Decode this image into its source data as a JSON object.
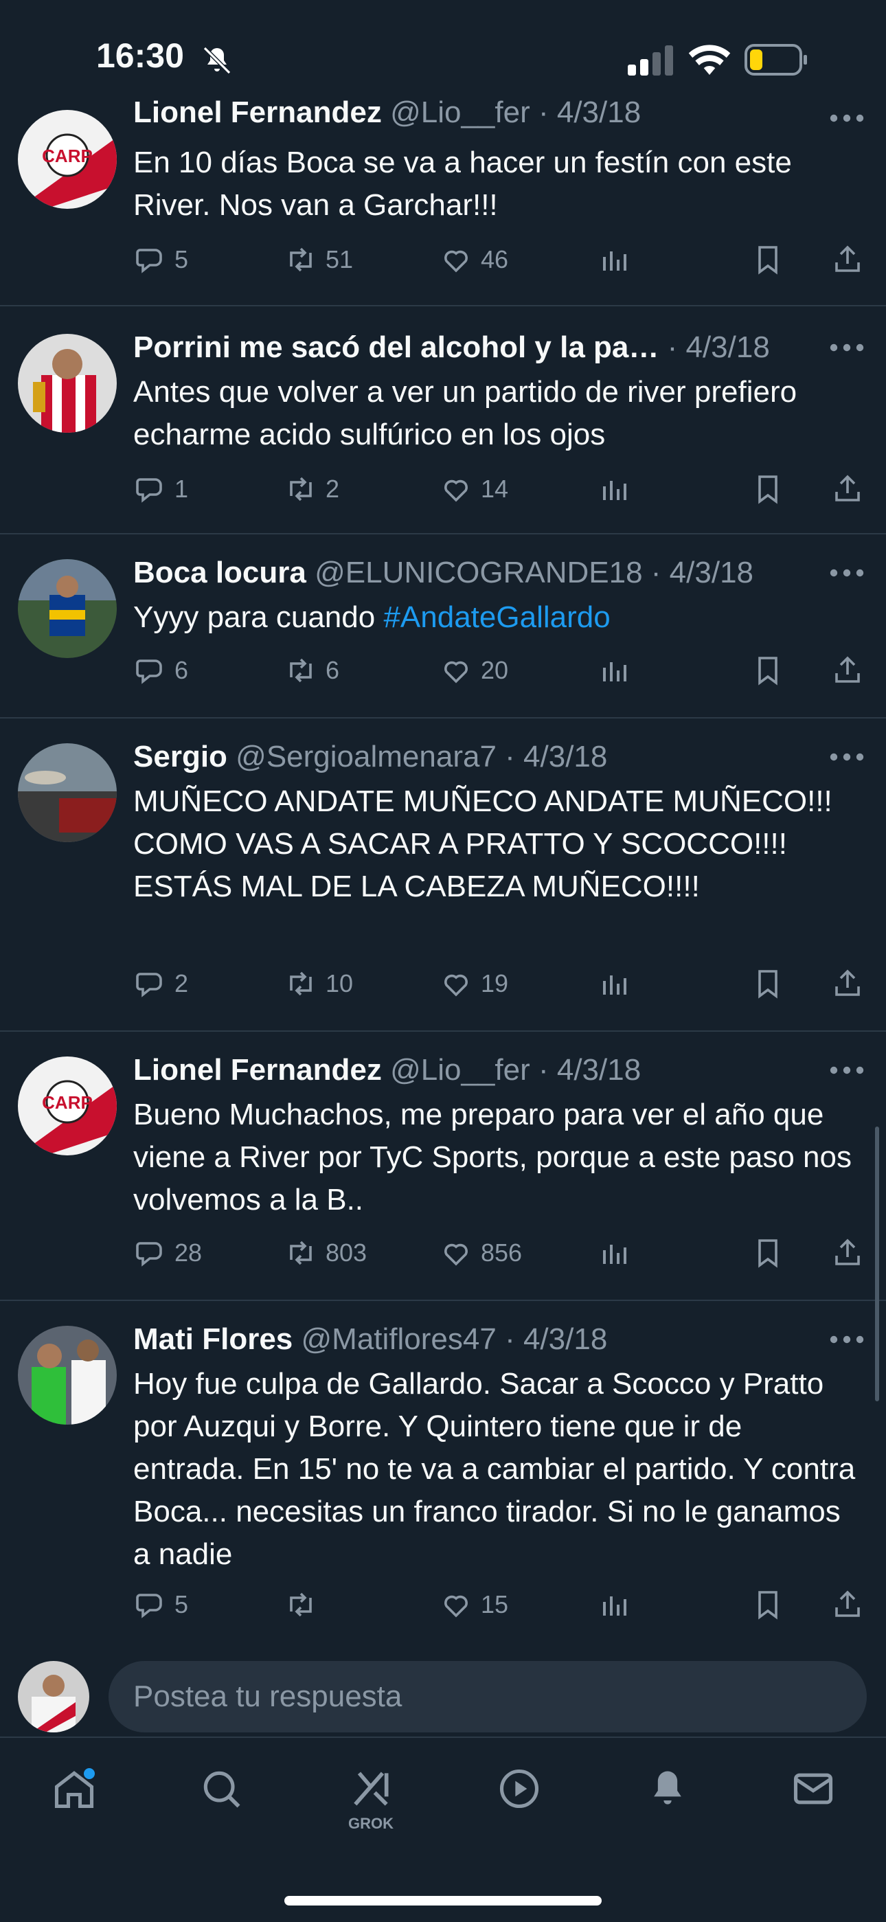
{
  "status_bar": {
    "time": "16:30"
  },
  "tweets": [
    {
      "name": "Lionel Fernandez",
      "handle": "@Lio__fer",
      "sep": " · ",
      "date": "4/3/18",
      "text": "En 10 días Boca se va a hacer un festín con este River. Nos van a Garchar!!!",
      "reply_count": "5",
      "retweet_count": "51",
      "like_count": "46"
    },
    {
      "name": "Porrini me sacó del alcohol y la pa…",
      "handle": "",
      "sep": " · ",
      "date": "4/3/18",
      "text": "Antes que volver a ver un partido de river prefiero echarme acido sulfúrico en los ojos",
      "reply_count": "1",
      "retweet_count": "2",
      "like_count": "14"
    },
    {
      "name": "Boca locura",
      "handle": "@ELUNICOGRANDE18",
      "sep": " · ",
      "date": "4/3/18",
      "text": "Yyyy para cuando ",
      "hashtag": "#AndateGallardo",
      "reply_count": "6",
      "retweet_count": "6",
      "like_count": "20"
    },
    {
      "name": "Sergio",
      "handle": "@Sergioalmenara7",
      "sep": " · ",
      "date": "4/3/18",
      "text": "MUÑECO ANDATE MUÑECO ANDATE MUÑECO!!! COMO VAS A SACAR A PRATTO Y SCOCCO!!!! ESTÁS MAL DE LA CABEZA MUÑECO!!!!",
      "reply_count": "2",
      "retweet_count": "10",
      "like_count": "19"
    },
    {
      "name": "Lionel Fernandez",
      "handle": "@Lio__fer",
      "sep": " · ",
      "date": "4/3/18",
      "text": "Bueno Muchachos, me preparo para ver el año que viene a River por TyC Sports, porque a este paso nos volvemos a la B..",
      "reply_count": "28",
      "retweet_count": "803",
      "like_count": "856"
    },
    {
      "name": "Mati Flores",
      "handle": "@Matiflores47",
      "sep": " · ",
      "date": "4/3/18",
      "text": "Hoy fue culpa de Gallardo. Sacar a Scocco y Pratto por Auzqui y Borre. Y Quintero tiene que ir de entrada. En 15' no te va a cambiar el partido. Y contra Boca... necesitas un franco tirador. Si no le ganamos a nadie",
      "reply_count": "5",
      "retweet_count": "",
      "like_count": "15"
    }
  ],
  "reply": {
    "placeholder": "Postea tu respuesta"
  },
  "tabs": {
    "grok_label": "GROK"
  },
  "icons": [
    "mute-icon",
    "signal-icon",
    "wifi-icon",
    "battery-icon",
    "more-icon",
    "reply-icon",
    "retweet-icon",
    "like-icon",
    "views-icon",
    "bookmark-icon",
    "share-icon",
    "home-icon",
    "search-icon",
    "grok-icon",
    "play-icon",
    "bell-icon",
    "mail-icon"
  ],
  "colors": {
    "background": "#15202b",
    "text": "#f7f9f9",
    "muted": "#8b98a5",
    "link": "#1d9bf0",
    "battery": "#ffd60a"
  }
}
